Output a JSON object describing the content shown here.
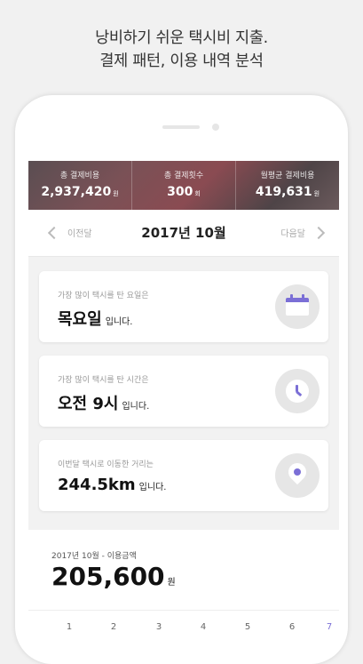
{
  "headline": {
    "line1": "낭비하기 쉬운 택시비 지출.",
    "line2": "결제 패턴, 이용 내역 분석"
  },
  "stats": [
    {
      "label": "총 결제비용",
      "value": "2,937,420",
      "unit": "원"
    },
    {
      "label": "총 결제횟수",
      "value": "300",
      "unit": "회"
    },
    {
      "label": "월평균 결제비용",
      "value": "419,631",
      "unit": "원"
    }
  ],
  "month_nav": {
    "prev": "이전달",
    "title": "2017년 10월",
    "next": "다음달"
  },
  "cards": [
    {
      "label": "가장 많이 택시를 탄 요일은",
      "value": "목요일",
      "suffix": "입니다.",
      "icon": "calendar-icon"
    },
    {
      "label": "가장 많이 택시를 탄 시간은",
      "value": "오전 9시",
      "suffix": "입니다.",
      "icon": "clock-icon"
    },
    {
      "label": "이번달 택시로 이동한 거리는",
      "value": "244.5km",
      "suffix": "입니다.",
      "icon": "location-pin-icon"
    }
  ],
  "usage": {
    "label": "2017년 10월 - 이용금액",
    "amount": "205,600",
    "unit": "원"
  },
  "days": [
    "1",
    "2",
    "3",
    "4",
    "5",
    "6",
    "7"
  ],
  "colors": {
    "accent": "#7b6fd6",
    "header_bg": "#6b4f55"
  }
}
